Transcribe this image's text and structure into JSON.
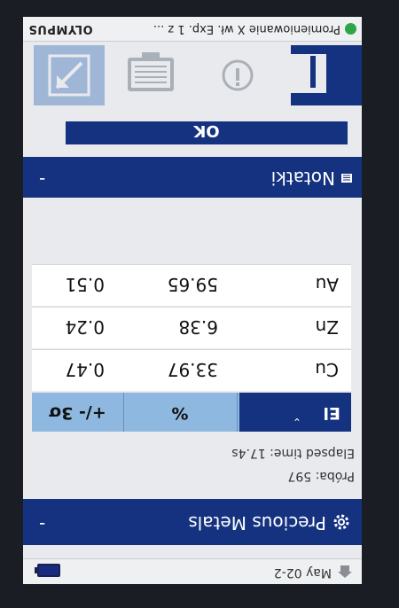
{
  "status": {
    "date": "May 02-2"
  },
  "header": {
    "title": "Precious Metals",
    "chevron": "-"
  },
  "info": {
    "sample": "Próba: 597",
    "elapsed": "Elapsed time: 17.4s"
  },
  "table": {
    "columns": [
      "El",
      "%",
      "+/- 3σ"
    ],
    "sort_indicator": "⌄",
    "rows": [
      {
        "el": "Cu",
        "pct": "33.97",
        "sigma": "0.47"
      },
      {
        "el": "Zn",
        "pct": "6.38",
        "sigma": "0.24"
      },
      {
        "el": "Au",
        "pct": "59.65",
        "sigma": "0.51"
      }
    ]
  },
  "notes": {
    "label": "Notatki",
    "chevron": "-"
  },
  "ok_label": "OK",
  "toolbar": [
    "results-icon",
    "info-icon",
    "report-icon",
    "export-icon"
  ],
  "footer": {
    "message": "Promieniowanie X wł.  Exp. 1 z ...",
    "brand": "OLYMPUS"
  },
  "colors": {
    "primary": "#14327f",
    "header_cell": "#8fb8e0",
    "status_ok": "#2fa548",
    "background": "#e9eaee"
  }
}
